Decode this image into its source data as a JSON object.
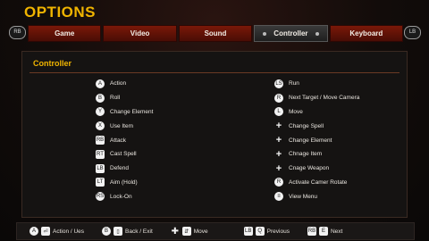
{
  "header": {
    "title": "OPTIONS"
  },
  "bumpers": {
    "left": "RB",
    "right": "LB"
  },
  "tabs": [
    {
      "label": "Game"
    },
    {
      "label": "Video"
    },
    {
      "label": "Sound"
    },
    {
      "label": "Controller",
      "active": true
    },
    {
      "label": "Keyboard"
    }
  ],
  "panel": {
    "title": "Controller"
  },
  "left_bindings": [
    {
      "glyph": "A",
      "label": "Action",
      "icon": "a-button-icon"
    },
    {
      "glyph": "B",
      "label": "Roll",
      "icon": "b-button-icon"
    },
    {
      "glyph": "Y",
      "label": "Change Element",
      "icon": "y-button-icon"
    },
    {
      "glyph": "X",
      "label": "Use Item",
      "icon": "x-button-icon"
    },
    {
      "glyph": "RB",
      "label": "Attack",
      "icon": "rb-button-icon"
    },
    {
      "glyph": "RT",
      "label": "Cast Spell",
      "icon": "rt-button-icon"
    },
    {
      "glyph": "LB",
      "label": "Defend",
      "icon": "lb-button-icon"
    },
    {
      "glyph": "LT",
      "label": "Aim (Hold)",
      "icon": "lt-button-icon"
    },
    {
      "glyph": "RS",
      "label": "Lock-On",
      "icon": "right-stick-icon"
    }
  ],
  "right_bindings": [
    {
      "glyph": "LS",
      "label": "Run",
      "icon": "left-stick-click-icon"
    },
    {
      "glyph": "R",
      "label": "Next Target / Move Camera",
      "icon": "right-stick-icon"
    },
    {
      "glyph": "L",
      "label": "Move",
      "icon": "left-stick-icon"
    },
    {
      "glyph": "+",
      "label": "Change Spell",
      "icon": "dpad-icon"
    },
    {
      "glyph": "+",
      "label": "Change Element",
      "icon": "dpad-icon"
    },
    {
      "glyph": "+",
      "label": "Chnage Item",
      "icon": "dpad-icon"
    },
    {
      "glyph": "+",
      "label": "Cnage Weapon",
      "icon": "dpad-icon"
    },
    {
      "glyph": "R",
      "label": "Activate Camer Rotate",
      "icon": "right-stick-click-icon"
    },
    {
      "glyph": "≡",
      "label": "View Menu",
      "icon": "menu-button-icon"
    }
  ],
  "bottom_bar": [
    {
      "label": "Action / Ues",
      "icon": "a-button-icon"
    },
    {
      "label": "Back / Exit",
      "icon": "b-button-icon"
    },
    {
      "label": "Move",
      "icon": "dpad-icon"
    },
    {
      "label": "Previous",
      "icon": "lb-button-icon"
    },
    {
      "label": "Next",
      "icon": "rb-button-icon"
    }
  ],
  "colors": {
    "accent": "#f0b400",
    "tab_red": "#6a1307",
    "tab_active": "#2e2e2e",
    "panel_bg": "#151312"
  }
}
